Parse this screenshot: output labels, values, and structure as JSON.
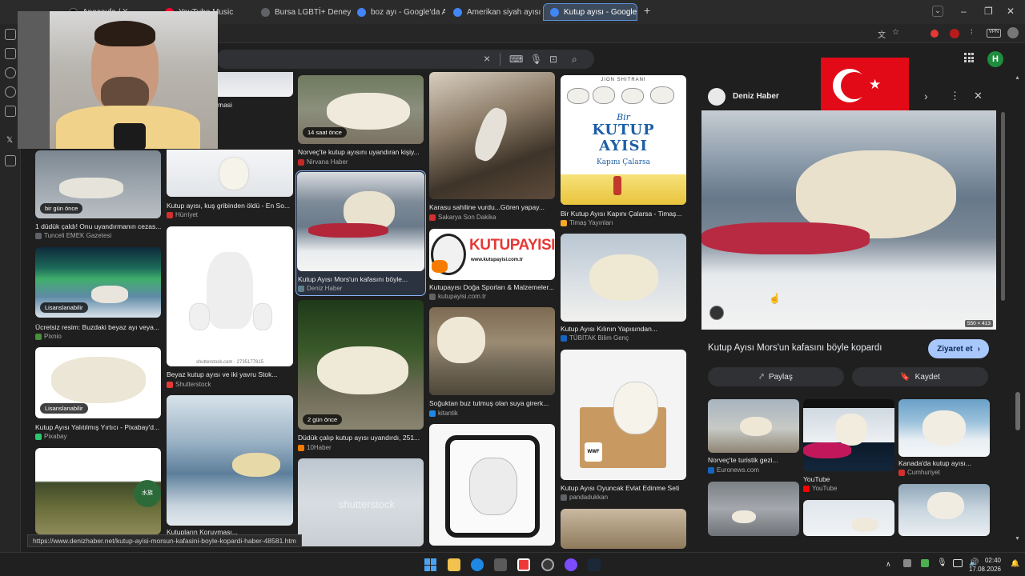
{
  "tabs": [
    {
      "label": "Apacayfa / X",
      "color": "#111111"
    },
    {
      "label": "YouTube Music",
      "color": "#ff0033"
    },
    {
      "label": "Bursa LGBTİ+ Deneyimi Öz",
      "color": "#5f6368"
    },
    {
      "label": "boz ayı - Google'da Ara",
      "color": "#4285f4"
    },
    {
      "label": "Amerikan siyah ayısı - Goo",
      "color": "#4285f4"
    },
    {
      "label": "Kutup ayısı - Google'da Ara",
      "color": "#4285f4",
      "active": true
    }
  ],
  "new_tab_label": "+",
  "search": {
    "clear_icon": "×"
  },
  "grid": {
    "col1": [
      {
        "caption": "1 düdük çaldı! Onu uyandırmanın cezas...",
        "source": "Tunceli EMEK Gazetesi",
        "badge": "bir gün önce",
        "src_color": "#5f6368"
      },
      {
        "caption": "Ücretsiz resim: Buzdaki beyaz ayı veya...",
        "source": "Pixnio",
        "badge": "Lisanslanabilir",
        "src_color": "#4a8f3c"
      },
      {
        "caption": "Kutup Ayısı Yalıtılmış Yırtıcı - Pixabay'd...",
        "source": "Pixabay",
        "badge": "Lisanslanabilir",
        "src_color": "#2ec66d"
      }
    ],
    "col2": [
      {
        "caption": "masi",
        "source": ""
      },
      {
        "caption": "Kutup ayısı, kuş gribinden öldü - En So...",
        "source": "Hürriyet",
        "src_color": "#d32f2f"
      },
      {
        "caption": "Beyaz kutup ayısı ve iki yavru Stok...",
        "source": "Shutterstock",
        "src_color": "#e53935",
        "watermark": "shutterstock.com · 2735177815"
      },
      {
        "caption": "Kutupların Koruyması...",
        "source": ""
      }
    ],
    "col3": [
      {
        "caption": "Norveç'te kutup ayısını uyandıran kişiy...",
        "source": "Nirvana Haber",
        "badge": "14 saat önce",
        "src_color": "#c62828"
      },
      {
        "caption": "Kutup Ayısı Mors'un kafasını böyle...",
        "source": "Deniz Haber",
        "src_color": "#607d8b"
      },
      {
        "caption": "Düdük çalıp kutup ayısı uyandırdı, 251...",
        "source": "10Haber",
        "badge": "2 gün önce",
        "src_color": "#f57c00"
      },
      {
        "caption": "",
        "source": "",
        "watermark": "shutterstock"
      }
    ],
    "col4": [
      {
        "caption": "Karasu sahiline vurdu...Gören yapay...",
        "source": "Sakarya Son Dakika",
        "src_color": "#d32f2f"
      },
      {
        "caption": "Kutupayısı Doğa Sporları & Malzemeler...",
        "source": "kutupayisi.com.tr",
        "src_color": "#5f6368"
      },
      {
        "caption": "Soğuktan buz tutmuş olan suya girerk...",
        "source": "kitantik",
        "src_color": "#1e88e5"
      }
    ],
    "col5": [
      {
        "caption": "Bir Kutup Ayısı Kapını Çalarsa - Timaş...",
        "source": "Timaş Yayınları",
        "src_color": "#f9a825"
      },
      {
        "caption": "Kutup Ayısı Kılının Yapısından...",
        "source": "TÜBİTAK Bilim Genç",
        "src_color": "#1565c0"
      },
      {
        "caption": "Kutup Ayısı Oyuncak Evlat Edinme Seti",
        "source": "pandadukkan",
        "src_color": "#5f6368"
      }
    ]
  },
  "book": {
    "author": "JION SHITRANI",
    "line1": "Bir",
    "line2": "KUTUP",
    "line3": "AYISI",
    "line4": "Kapını Çalarsa"
  },
  "kutupayisi_logo": {
    "text": "KUTUPAYISI",
    "url": "www.kutupayisi.com.tr"
  },
  "toy_brand": "WWF",
  "panel": {
    "source_name": "Deniz Haber",
    "title": "Kutup Ayısı Mors'un kafasını böyle kopardı",
    "visit_label": "Ziyaret et",
    "share_label": "Paylaş",
    "save_label": "Kaydet",
    "image_size": "550 × 413",
    "related": [
      {
        "caption": "Norveç'te turistik gezi...",
        "source": "Euronews.com",
        "src_color": "#1565c0"
      },
      {
        "caption": "YouTube",
        "source": "YouTube",
        "src_color": "#ff0000"
      },
      {
        "caption": "Kanada'da kutup ayısı...",
        "source": "Cumhuriyet",
        "src_color": "#d32f2f"
      }
    ]
  },
  "profile_initial": "H",
  "status_url": "https://www.denizhaber.net/kutup-ayisi-morsun-kafasini-boyle-kopardi-haber-48581.htm",
  "clock": {
    "time": "02:40",
    "date": "17.08.2026"
  },
  "colors": {
    "accent": "#8ab4f8",
    "visit_button": "#a8c7fa",
    "flag_red": "#e30a17"
  }
}
